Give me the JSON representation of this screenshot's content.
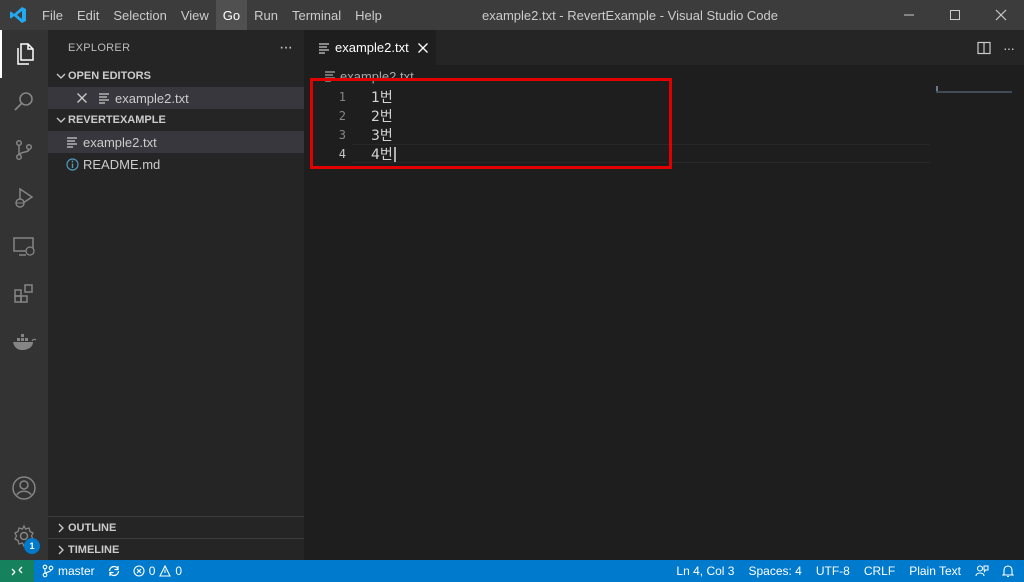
{
  "menu": [
    "File",
    "Edit",
    "Selection",
    "View",
    "Go",
    "Run",
    "Terminal",
    "Help"
  ],
  "menu_active": "Go",
  "window_title": "example2.txt - RevertExample - Visual Studio Code",
  "sidebar": {
    "title": "EXPLORER",
    "more": "···",
    "open_editors_label": "OPEN EDITORS",
    "open_editor_file": "example2.txt",
    "workspace_label": "REVERTEXAMPLE",
    "files": [
      "example2.txt",
      "README.md"
    ],
    "outline_label": "OUTLINE",
    "timeline_label": "TIMELINE"
  },
  "editor": {
    "tab_label": "example2.txt",
    "breadcrumb": "example2.txt",
    "lines": [
      {
        "number": "1",
        "text": "1번"
      },
      {
        "number": "2",
        "text": "2번"
      },
      {
        "number": "3",
        "text": "3번"
      },
      {
        "number": "4",
        "text": "4번"
      }
    ],
    "current_line": 4
  },
  "activity": {
    "settings_badge": "1"
  },
  "status": {
    "branch": "master",
    "errors": "0",
    "warnings": "0",
    "position": "Ln 4, Col 3",
    "spaces": "Spaces: 4",
    "encoding": "UTF-8",
    "eol": "CRLF",
    "language": "Plain Text"
  },
  "colors": {
    "accent": "#007acc",
    "remote": "#16825d",
    "highlight": "#e00000",
    "vscode_blue": "#23a9f2"
  },
  "icons": {
    "logo": "vscode-logo-icon",
    "explorer": "files-icon",
    "search": "search-icon",
    "scm": "source-control-icon",
    "debug": "run-debug-icon",
    "remote_explorer": "remote-explorer-icon",
    "extensions": "extensions-icon",
    "docker": "docker-icon",
    "account": "account-icon",
    "settings": "gear-icon"
  }
}
